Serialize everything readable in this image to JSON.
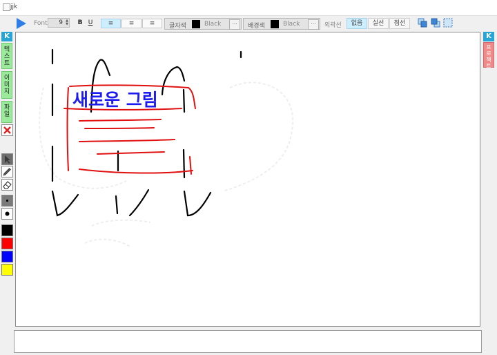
{
  "window": {
    "title": "jjk"
  },
  "toolbar": {
    "font_label": "Font",
    "font_size": "9",
    "bold_label": "B",
    "underline_label": "U",
    "align_left": "≡",
    "align_center": "≡",
    "align_right": "≡",
    "text_color_label": "글자색",
    "text_color_name": "Black",
    "text_color_hex": "#000000",
    "bg_color_label": "배경색",
    "bg_color_name": "Black",
    "bg_color_hex": "#000000",
    "more_label": "…",
    "outline_label": "외곽선",
    "outline_options": [
      "없음",
      "실선",
      "점선"
    ],
    "outline_selected": "없음"
  },
  "left_panel": {
    "collapse_label": "K",
    "tabs": [
      "텍스트",
      "이미지",
      "파일"
    ],
    "palette": [
      "#000000",
      "#ff0000",
      "#0000ff",
      "#ffff00"
    ]
  },
  "right_panel": {
    "collapse_label": "K",
    "tab_label": "프로젝트"
  },
  "canvas": {
    "drawing_text": "새로운 그림",
    "ink_colors": {
      "black": "#000000",
      "blue": "#1c1cf0",
      "red": "#e01010"
    }
  },
  "colors": {
    "accent": "#28a5d6",
    "tab_green": "#9bea9b",
    "tab_red": "#f08a8a",
    "selected": "#cdeefe"
  }
}
